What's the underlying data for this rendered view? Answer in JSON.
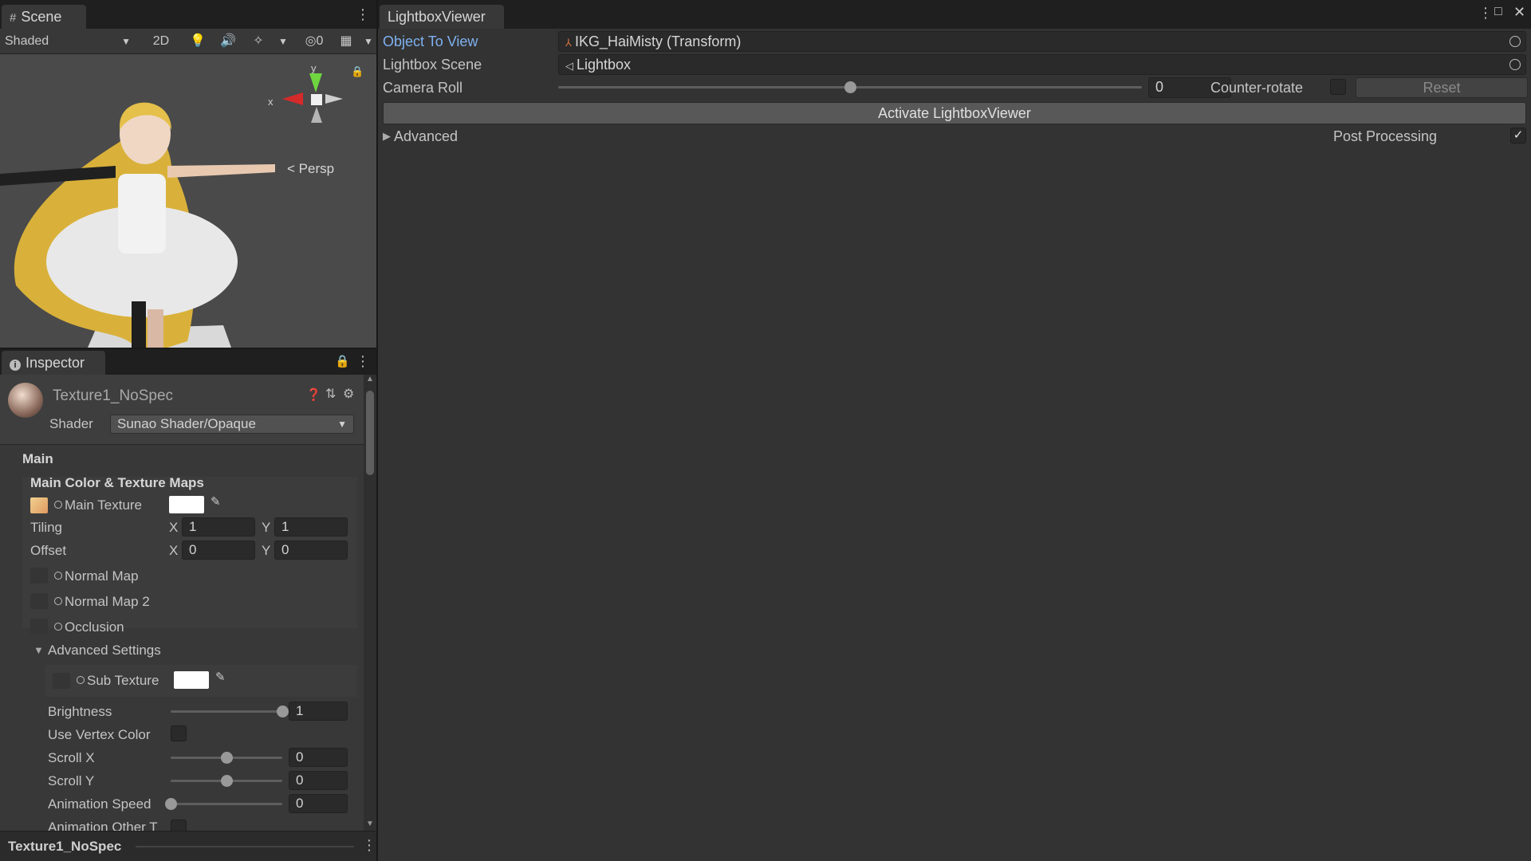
{
  "scene": {
    "tab_label": "Scene",
    "shading_mode": "Shaded",
    "mode_2d": "2D",
    "hidden_count": "0",
    "gizmo": {
      "y": "y",
      "x": "x",
      "persp": "Persp"
    }
  },
  "inspector": {
    "tab_label": "Inspector",
    "material_name": "Texture1_NoSpec",
    "shader_label": "Shader",
    "shader_value": "Sunao Shader/Opaque",
    "section_main": "Main",
    "group_title": "Main Color & Texture Maps",
    "main_texture_label": "Main Texture",
    "tiling_label": "Tiling",
    "tiling_x": "1",
    "tiling_y": "1",
    "offset_label": "Offset",
    "offset_x": "0",
    "offset_y": "0",
    "axis_x": "X",
    "axis_y": "Y",
    "normal_map_label": "Normal Map",
    "normal_map2_label": "Normal Map 2",
    "occlusion_label": "Occlusion",
    "advanced_settings_label": "Advanced Settings",
    "sub_texture_label": "Sub Texture",
    "brightness_label": "Brightness",
    "brightness_value": "1",
    "brightness_level": 1.0,
    "use_vertex_color_label": "Use Vertex Color",
    "scroll_x_label": "Scroll X",
    "scroll_x_value": "0",
    "scroll_x_level": 0.5,
    "scroll_y_label": "Scroll Y",
    "scroll_y_value": "0",
    "scroll_y_level": 0.5,
    "animation_speed_label": "Animation Speed",
    "animation_speed_value": "0",
    "animation_speed_level": 0.0,
    "animation_other_label": "Animation Other T",
    "footer_name": "Texture1_NoSpec"
  },
  "lightbox": {
    "tab_label": "LightboxViewer",
    "object_to_view_label": "Object To View",
    "object_to_view_value": "IKG_HaiMisty (Transform)",
    "lightbox_scene_label": "Lightbox Scene",
    "lightbox_scene_value": "Lightbox",
    "camera_roll_label": "Camera Roll",
    "camera_roll_value": "0",
    "camera_roll_level": 0.5,
    "counter_rotate_label": "Counter-rotate",
    "reset_label": "Reset",
    "activate_label": "Activate LightboxViewer",
    "advanced_label": "Advanced",
    "post_processing_label": "Post Processing",
    "post_processing_checked": true
  },
  "colors": {
    "accent_link": "#7fb1f0",
    "panel_bg": "#383838",
    "tab_bg": "#1f1f1f"
  }
}
